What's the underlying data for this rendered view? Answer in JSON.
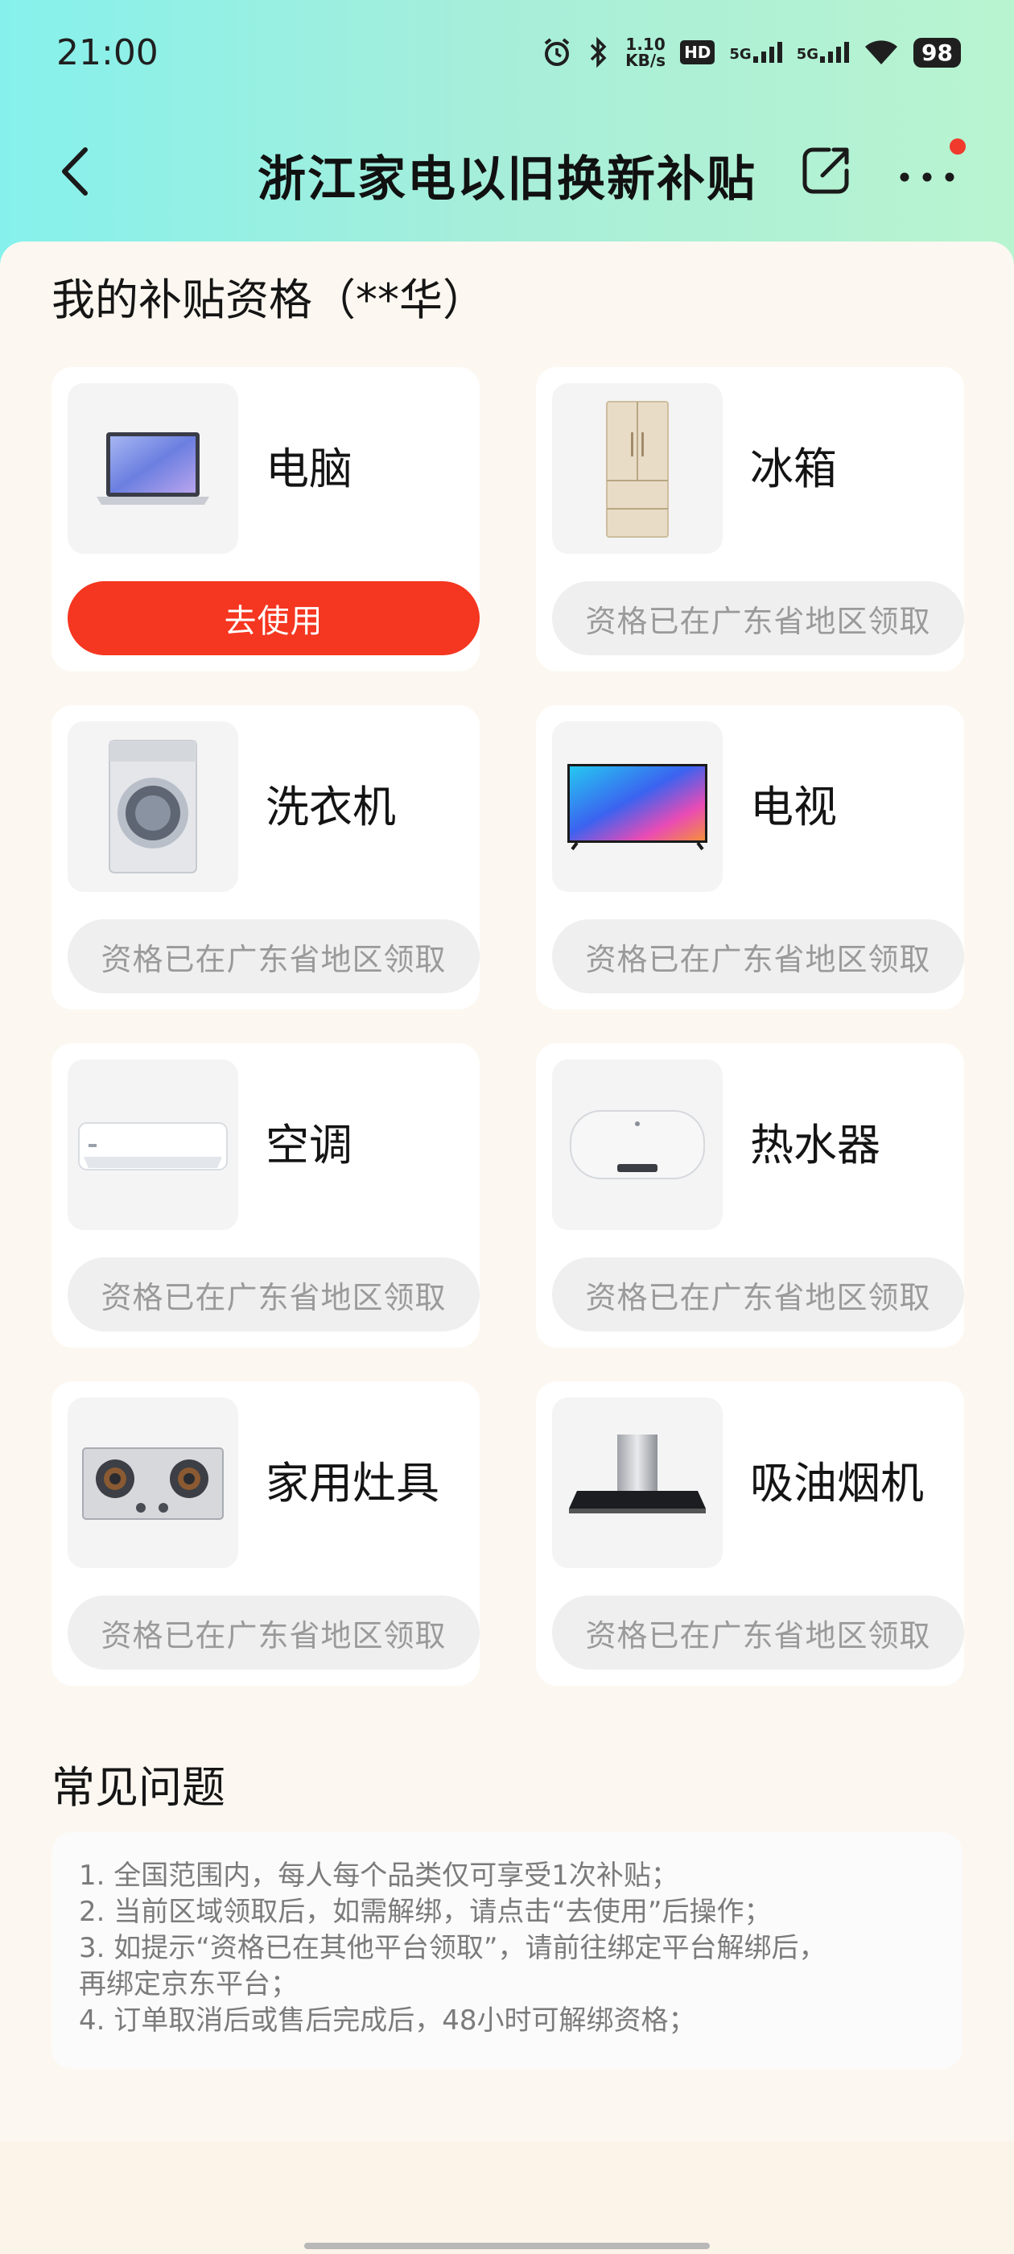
{
  "status": {
    "time": "21:00",
    "speed_top": "1.10",
    "speed_bottom": "KB/s",
    "hd": "HD",
    "sim1": "5G",
    "sim2": "5G",
    "battery": "98"
  },
  "nav": {
    "title": "浙江家电以旧换新补贴"
  },
  "eligibility": {
    "title": "我的补贴资格（**华）",
    "items": [
      {
        "label": "电脑",
        "button": "去使用",
        "icon": "laptop-icon"
      },
      {
        "label": "冰箱",
        "button": "资格已在广东省地区领取",
        "icon": "fridge-icon"
      },
      {
        "label": "洗衣机",
        "button": "资格已在广东省地区领取",
        "icon": "washer-icon"
      },
      {
        "label": "电视",
        "button": "资格已在广东省地区领取",
        "icon": "tv-icon"
      },
      {
        "label": "空调",
        "button": "资格已在广东省地区领取",
        "icon": "ac-icon"
      },
      {
        "label": "热水器",
        "button": "资格已在广东省地区领取",
        "icon": "water-heater-icon"
      },
      {
        "label": "家用灶具",
        "button": "资格已在广东省地区领取",
        "icon": "stove-icon"
      },
      {
        "label": "吸油烟机",
        "button": "资格已在广东省地区领取",
        "icon": "range-hood-icon"
      }
    ]
  },
  "faq": {
    "title": "常见问题",
    "lines": [
      "1. 全国范围内，每人每个品类仅可享受1次补贴；",
      "2. 当前区域领取后，如需解绑，请点击“去使用”后操作；",
      "3. 如提示“资格已在其他平台领取”，请前往绑定平台解绑后，",
      "再绑定京东平台；",
      "4. 订单取消后或售后完成后，48小时可解绑资格；"
    ]
  },
  "colors": {
    "primary_button": "#f53620",
    "disabled_button": "#efefef",
    "notification_dot": "#f03a2c"
  }
}
